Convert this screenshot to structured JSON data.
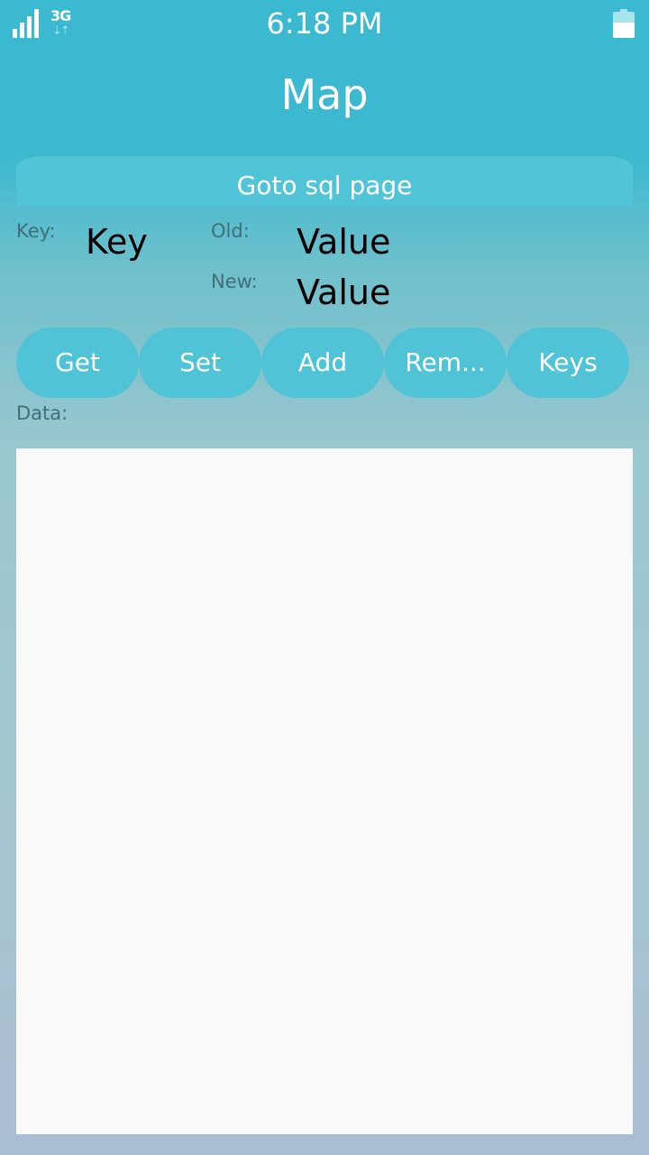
{
  "status_bar": {
    "time": "6:18 PM",
    "network": "3G",
    "network_arrows": "⇣⇡",
    "signal_level": 4,
    "battery_level": 0.6,
    "icons": [
      "signal-icon",
      "network-3g-icon",
      "battery-icon"
    ]
  },
  "header": {
    "title": "Map"
  },
  "goto_button": {
    "label": "Goto sql page"
  },
  "fields": {
    "key_label": "Key:",
    "key_value": "Key",
    "old_label": "Old:",
    "old_value": "Value",
    "new_label": "New:",
    "new_value": "Value"
  },
  "buttons": [
    {
      "label": "Get"
    },
    {
      "label": "Set"
    },
    {
      "label": "Add"
    },
    {
      "label": "Rem..."
    },
    {
      "label": "Keys"
    }
  ],
  "data_section": {
    "label": "Data:",
    "content": ""
  },
  "colors": {
    "accent": "#50c3d6",
    "header_bg": "#3bb9d0",
    "data_bg": "#f9f9f9",
    "label_text": "#3f6f78"
  }
}
